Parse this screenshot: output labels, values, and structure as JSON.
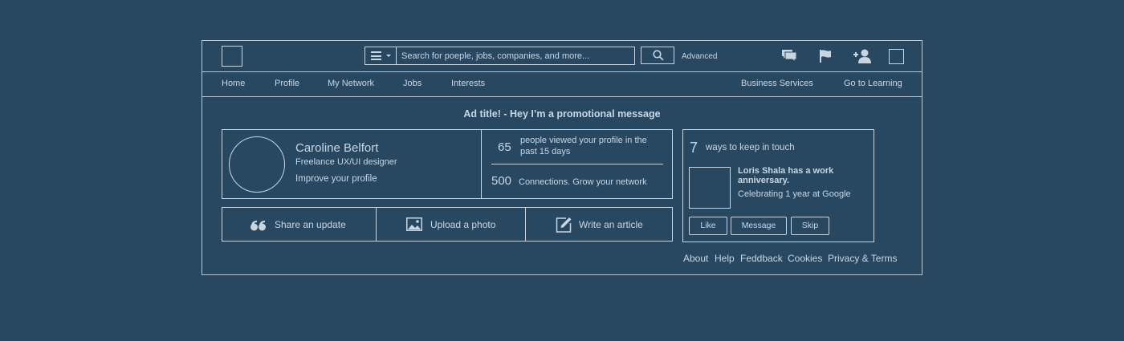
{
  "header": {
    "search_placeholder": "Search for poeple, jobs, companies, and more...",
    "advanced_label": "Advanced"
  },
  "nav": {
    "home": "Home",
    "profile": "Profile",
    "my_network": "My Network",
    "jobs": "Jobs",
    "interests": "Interests",
    "business_services": "Business Services",
    "go_to_learning": "Go to Learning"
  },
  "ad": {
    "title": "Ad title! - Hey I’m a promotional message"
  },
  "profile": {
    "name": "Caroline Belfort",
    "role": "Freelance UX/UI designer",
    "improve_link": "Improve your profile",
    "views_count": "65",
    "views_text": "people viewed your profile in the past 15 days",
    "connections_count": "500",
    "connections_text": "Connections. Grow your network"
  },
  "actions": {
    "share": "Share an update",
    "upload": "Upload a photo",
    "article": "Write an article"
  },
  "keep_in_touch": {
    "count": "7",
    "title": "ways to keep in touch",
    "headline": "Loris Shala has a work anniversary.",
    "detail": "Celebrating 1 year at Google",
    "like": "Like",
    "message": "Message",
    "skip": "Skip"
  },
  "footer": {
    "about": "About",
    "help": "Help",
    "feedback": "Feddback",
    "cookies": "Cookies",
    "privacy": "Privacy & Terms"
  },
  "icons": [
    "logo-placeholder",
    "menu-icon",
    "search-icon",
    "messages-icon",
    "flag-icon",
    "add-contact-icon",
    "me-placeholder",
    "quote-icon",
    "photo-icon",
    "pencil-icon"
  ],
  "colors": {
    "background": "#284862",
    "lines": "#c9d6e2"
  }
}
